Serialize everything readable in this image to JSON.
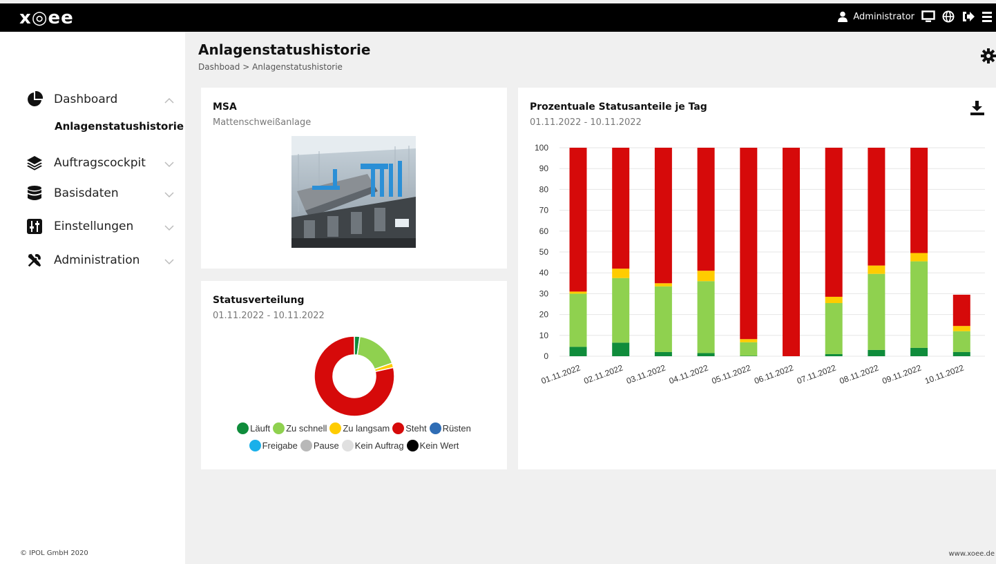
{
  "app": {
    "logo": "x◎ee",
    "user": "Administrator",
    "copyright": "© IPOL GmbH 2020",
    "website": "www.xoee.de"
  },
  "sidebar": {
    "items": [
      {
        "label": "Dashboard",
        "icon": "pie-chart-icon",
        "expanded": true
      },
      {
        "label": "Auftragscockpit",
        "icon": "layers-icon",
        "expanded": false
      },
      {
        "label": "Basisdaten",
        "icon": "database-icon",
        "expanded": false
      },
      {
        "label": "Einstellungen",
        "icon": "sliders-icon",
        "expanded": false
      },
      {
        "label": "Administration",
        "icon": "tools-icon",
        "expanded": false
      }
    ],
    "sub_item": "Anlagenstatushistorie"
  },
  "page": {
    "title": "Anlagenstatushistorie",
    "breadcrumb": "Dashboad > Anlagenstatushistorie"
  },
  "msa_card": {
    "title": "MSA",
    "subtitle": "Mattenschweißanlage"
  },
  "status_card": {
    "title": "Statusverteilung",
    "subtitle": "01.11.2022 - 10.11.2022"
  },
  "bar_card": {
    "title": "Prozentuale Statusanteile je Tag",
    "subtitle": "01.11.2022 - 10.11.2022"
  },
  "colors": {
    "laeuft": "#0f8c3b",
    "zu_schnell": "#8fd14f",
    "zu_langsam": "#ffcc00",
    "steht": "#d60a0a",
    "ruesten": "#2f6db5",
    "freigabe": "#1ab0ea",
    "pause": "#b8b8b8",
    "kein_auftrag": "#e0e0e0",
    "kein_wert": "#000000"
  },
  "legend": [
    {
      "label": "Läuft",
      "color": "#0f8c3b"
    },
    {
      "label": "Zu schnell",
      "color": "#8fd14f"
    },
    {
      "label": "Zu langsam",
      "color": "#ffcc00"
    },
    {
      "label": "Steht",
      "color": "#d60a0a"
    },
    {
      "label": "Rüsten",
      "color": "#2f6db5"
    },
    {
      "label": "Freigabe",
      "color": "#1ab0ea"
    },
    {
      "label": "Pause",
      "color": "#b8b8b8"
    },
    {
      "label": "Kein Auftrag",
      "color": "#e0e0e0"
    },
    {
      "label": "Kein Wert",
      "color": "#000000"
    }
  ],
  "chart_data": [
    {
      "type": "pie",
      "donut": true,
      "title": "Statusverteilung",
      "labels": [
        "Läuft",
        "Zu schnell",
        "Zu langsam",
        "Steht",
        "Rüsten",
        "Freigabe",
        "Pause",
        "Kein Auftrag",
        "Kein Wert"
      ],
      "values": [
        2.2,
        17.5,
        1.8,
        78.5,
        0,
        0,
        0,
        0,
        0
      ]
    },
    {
      "type": "bar",
      "stacked": true,
      "title": "Prozentuale Statusanteile je Tag",
      "categories": [
        "01.11.2022",
        "02.11.2022",
        "03.11.2022",
        "04.11.2022",
        "05.11.2022",
        "06.11.2022",
        "07.11.2022",
        "08.11.2022",
        "09.11.2022",
        "10.11.2022"
      ],
      "ylim": [
        0,
        100
      ],
      "yticks": [
        0,
        10,
        20,
        30,
        40,
        50,
        60,
        70,
        80,
        90,
        100
      ],
      "grid": true,
      "series": [
        {
          "name": "Läuft",
          "values": [
            4.5,
            6.5,
            2,
            1.5,
            0.2,
            0,
            1,
            3,
            4,
            2
          ]
        },
        {
          "name": "Zu schnell",
          "values": [
            25.5,
            31,
            31.5,
            34.5,
            6.5,
            0,
            24.5,
            36.5,
            41.5,
            10
          ]
        },
        {
          "name": "Zu langsam",
          "values": [
            1,
            4.5,
            1.5,
            5,
            1.5,
            0,
            3,
            4,
            4,
            2.5
          ]
        },
        {
          "name": "Steht",
          "values": [
            69,
            58,
            65,
            59,
            91.8,
            100,
            71.5,
            56.5,
            50.5,
            15
          ]
        }
      ]
    }
  ]
}
